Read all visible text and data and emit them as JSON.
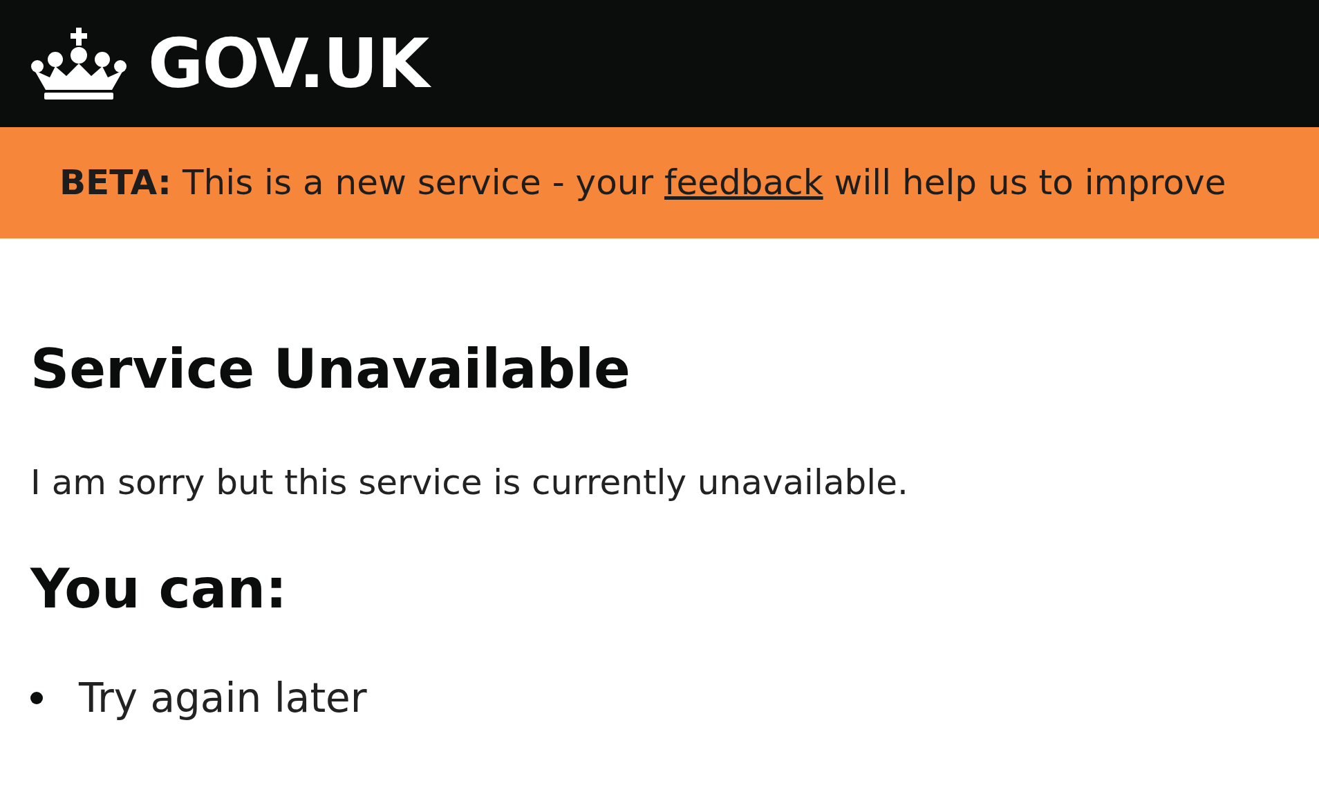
{
  "header": {
    "logo_text": "GOV.UK"
  },
  "phase_banner": {
    "tag": "BETA:",
    "text_before": "This is a new service - your",
    "link": "feedback",
    "text_after": "will help us to improve"
  },
  "title": "Service Unavailable",
  "message": "I am sorry but this service is currently unavailable.",
  "options_heading": "You can:",
  "options": [
    "Try again later"
  ]
}
